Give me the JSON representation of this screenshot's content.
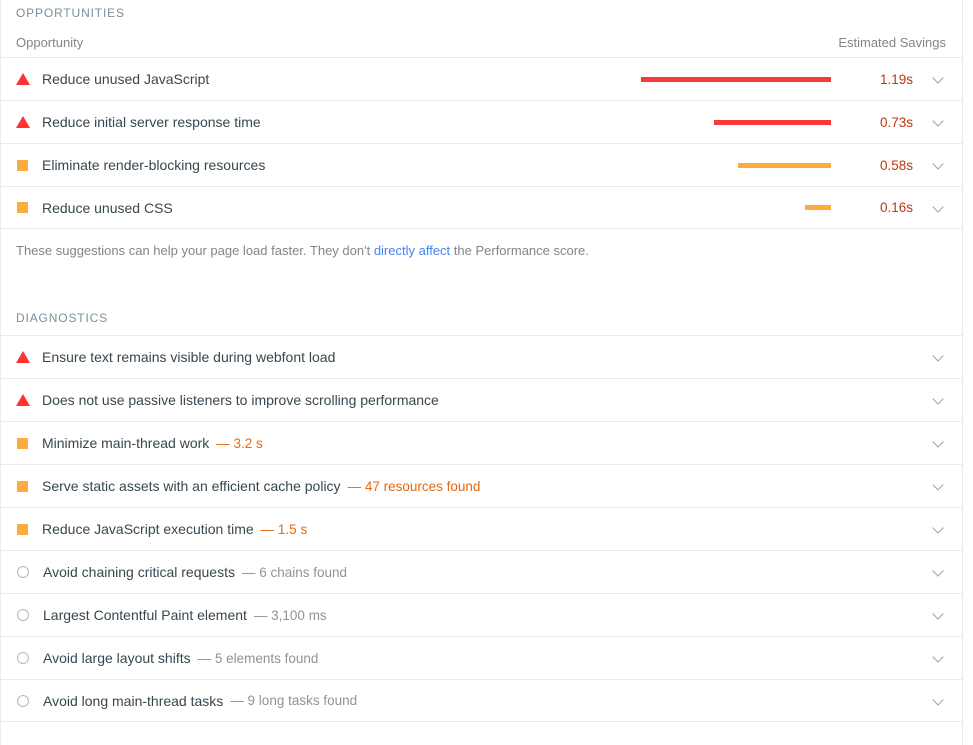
{
  "opportunities": {
    "section_label": "OPPORTUNITIES",
    "column_headers": {
      "left": "Opportunity",
      "right": "Estimated Savings"
    },
    "max_savings_seconds": 1.19,
    "rows": [
      {
        "icon": "triangle-fail-icon",
        "score": "fail",
        "title": "Reduce unused JavaScript",
        "savings": "1.19s",
        "savings_seconds": 1.19,
        "bar_color": "#f93939",
        "chevron": "chevron-down-icon"
      },
      {
        "icon": "triangle-fail-icon",
        "score": "fail",
        "title": "Reduce initial server response time",
        "savings": "0.73s",
        "savings_seconds": 0.73,
        "bar_color": "#f93939",
        "chevron": "chevron-down-icon"
      },
      {
        "icon": "square-average-icon",
        "score": "average",
        "title": "Eliminate render-blocking resources",
        "savings": "0.58s",
        "savings_seconds": 0.58,
        "bar_color": "#fbac3c",
        "chevron": "chevron-down-icon"
      },
      {
        "icon": "square-average-icon",
        "score": "average",
        "title": "Reduce unused CSS",
        "savings": "0.16s",
        "savings_seconds": 0.16,
        "bar_color": "#fbac3c",
        "chevron": "chevron-down-icon"
      }
    ],
    "footnote": {
      "before": "These suggestions can help your page load faster. They don't ",
      "link": "directly affect",
      "after": " the Performance score."
    }
  },
  "diagnostics": {
    "section_label": "DIAGNOSTICS",
    "rows": [
      {
        "icon": "triangle-fail-icon",
        "score": "fail",
        "title": "Ensure text remains visible during webfont load",
        "value": "",
        "chevron": "chevron-down-icon"
      },
      {
        "icon": "triangle-fail-icon",
        "score": "fail",
        "title": "Does not use passive listeners to improve scrolling performance",
        "value": "",
        "chevron": "chevron-down-icon"
      },
      {
        "icon": "square-average-icon",
        "score": "average",
        "title": "Minimize main-thread work",
        "value": "— 3.2 s",
        "chevron": "chevron-down-icon"
      },
      {
        "icon": "square-average-icon",
        "score": "average",
        "title": "Serve static assets with an efficient cache policy",
        "value": "— 47 resources found",
        "chevron": "chevron-down-icon"
      },
      {
        "icon": "square-average-icon",
        "score": "average",
        "title": "Reduce JavaScript execution time",
        "value": "— 1.5 s",
        "chevron": "chevron-down-icon"
      },
      {
        "icon": "circle-pass-icon",
        "score": "pass",
        "title": "Avoid chaining critical requests",
        "value": "— 6 chains found",
        "chevron": "chevron-down-icon"
      },
      {
        "icon": "circle-pass-icon",
        "score": "pass",
        "title": "Largest Contentful Paint element",
        "value": "— 3,100 ms",
        "chevron": "chevron-down-icon"
      },
      {
        "icon": "circle-pass-icon",
        "score": "pass",
        "title": "Avoid large layout shifts",
        "value": "— 5 elements found",
        "chevron": "chevron-down-icon"
      },
      {
        "icon": "circle-pass-icon",
        "score": "pass",
        "title": "Avoid long main-thread tasks",
        "value": "— 9 long tasks found",
        "chevron": "chevron-down-icon"
      }
    ]
  },
  "colors": {
    "fail": "#ff3333",
    "average": "#fbac3c",
    "pass": "#b4b8bb",
    "savings_text": "#c1350e",
    "link": "#4285f4"
  }
}
